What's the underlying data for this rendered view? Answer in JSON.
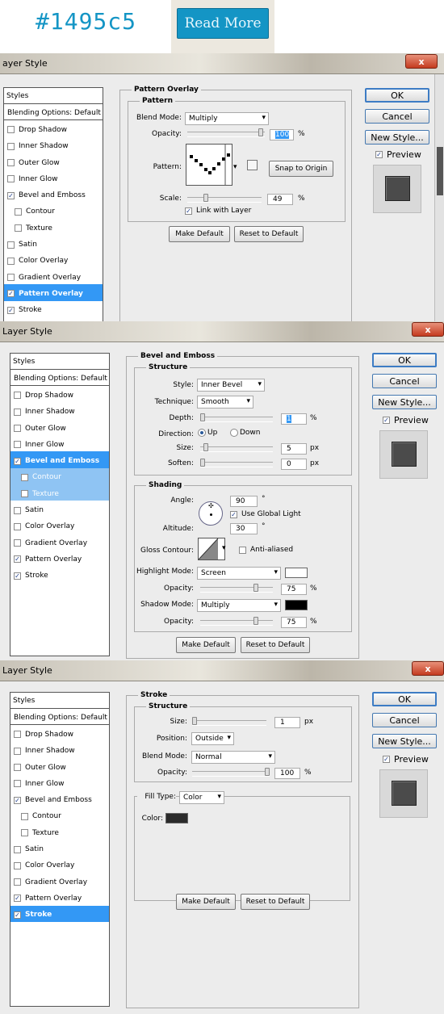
{
  "header": {
    "hex_label": "#1495c5",
    "button_label": "Read More",
    "accent": "#1495c5"
  },
  "common": {
    "window_title": "Layer Style",
    "close_glyph": "x",
    "styles": "Styles",
    "blending": "Blending Options: Default",
    "items": {
      "drop_shadow": "Drop Shadow",
      "inner_shadow": "Inner Shadow",
      "outer_glow": "Outer Glow",
      "inner_glow": "Inner Glow",
      "bevel": "Bevel and Emboss",
      "contour": "Contour",
      "texture": "Texture",
      "satin": "Satin",
      "color_overlay": "Color Overlay",
      "gradient_overlay": "Gradient Overlay",
      "pattern_overlay": "Pattern Overlay",
      "stroke": "Stroke"
    },
    "ok": "OK",
    "cancel": "Cancel",
    "new_style": "New Style...",
    "preview": "Preview",
    "make_default": "Make Default",
    "reset_default": "Reset to Default",
    "percent": "%",
    "px": "px",
    "degree": "°"
  },
  "dialog1": {
    "window_title": "ayer Style",
    "section": "Pattern Overlay",
    "group": "Pattern",
    "blend_mode_label": "Blend Mode:",
    "blend_mode": "Multiply",
    "opacity_label": "Opacity:",
    "opacity": "100",
    "pattern_label": "Pattern:",
    "snap": "Snap to Origin",
    "scale_label": "Scale:",
    "scale": "49",
    "link": "Link with Layer"
  },
  "dialog2": {
    "section": "Bevel and Emboss",
    "structure": "Structure",
    "style_label": "Style:",
    "style": "Inner Bevel",
    "technique_label": "Technique:",
    "technique": "Smooth",
    "depth_label": "Depth:",
    "depth": "1",
    "direction_label": "Direction:",
    "up": "Up",
    "down": "Down",
    "size_label": "Size:",
    "size": "5",
    "soften_label": "Soften:",
    "soften": "0",
    "shading": "Shading",
    "angle_label": "Angle:",
    "angle": "90",
    "global_light": "Use Global Light",
    "altitude_label": "Altitude:",
    "altitude": "30",
    "gloss_label": "Gloss Contour:",
    "anti_aliased": "Anti-aliased",
    "highlight_label": "Highlight Mode:",
    "highlight_mode": "Screen",
    "highlight_opacity": "75",
    "shadow_label": "Shadow Mode:",
    "shadow_mode": "Multiply",
    "shadow_opacity": "75",
    "opacity_label": "Opacity:",
    "highlight_color": "#ffffff",
    "shadow_color": "#000000"
  },
  "dialog3": {
    "section": "Stroke",
    "structure": "Structure",
    "size_label": "Size:",
    "size": "1",
    "position_label": "Position:",
    "position": "Outside",
    "blend_label": "Blend Mode:",
    "blend_mode": "Normal",
    "opacity_label": "Opacity:",
    "opacity": "100",
    "fill_type_label": "Fill Type:",
    "fill_type": "Color",
    "color_label": "Color:",
    "color": "#2b2b2b"
  }
}
